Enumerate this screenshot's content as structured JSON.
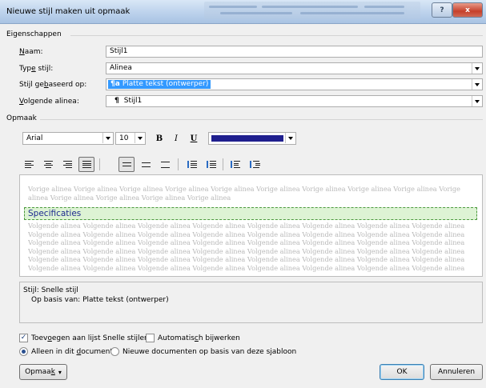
{
  "window": {
    "title": "Nieuwe stijl maken uit opmaak",
    "help_glyph": "?",
    "close_glyph": "x"
  },
  "eigenschappen": {
    "heading": "Eigenschappen",
    "naam_label": {
      "before": "",
      "key": "N",
      "after": "aam:"
    },
    "naam_value": "Stijl1",
    "type_label": {
      "before": "Typ",
      "key": "e",
      "after": " stijl:"
    },
    "type_value": "Alinea",
    "gebaseerd_label": {
      "before": "Stijl ge",
      "key": "b",
      "after": "aseerd op:"
    },
    "gebaseerd_value": "Platte tekst (ontwerper)",
    "gebaseerd_icon_glyph": "¶a",
    "volgende_label": {
      "before": "",
      "key": "V",
      "after": "olgende alinea:"
    },
    "volgende_value": "Stijl1",
    "volgende_icon_glyph": "¶"
  },
  "opmaak": {
    "heading": "Opmaak",
    "font": "Arial",
    "size": "10",
    "bold_glyph": "B",
    "italic_glyph": "I",
    "underline_glyph": "U",
    "font_color": "#1f1f8e"
  },
  "preview": {
    "previous_paragraph": "Vorige alinea Vorige alinea Vorige alinea Vorige alinea Vorige alinea Vorige alinea Vorige alinea Vorige alinea Vorige alinea Vorige alinea Vorige alinea Vorige alinea Vorige alinea Vorige alinea",
    "sample_text": "Specificaties",
    "next_paragraph": "Volgende alinea Volgende alinea Volgende alinea Volgende alinea Volgende alinea Volgende alinea Volgende alinea Volgende alinea Volgende alinea Volgende alinea Volgende alinea Volgende alinea Volgende alinea Volgende alinea Volgende alinea Volgende alinea Volgende alinea Volgende alinea Volgende alinea Volgende alinea Volgende alinea Volgende alinea Volgende alinea Volgende alinea Volgende alinea Volgende alinea Volgende alinea Volgende alinea Volgende alinea Volgende alinea Volgende alinea Volgende alinea Volgende alinea Volgende alinea Volgende alinea Volgende alinea Volgende alinea Volgende alinea Volgende alinea Volgende alinea Volgende alinea Volgende alinea Volgende alinea Volgende alinea Volgende alinea Volgende alinea Volgende alinea Volgende alinea"
  },
  "description": {
    "line1": "Stijl: Snelle stijl",
    "line2": "Op basis van: Platte tekst (ontwerper)"
  },
  "options": {
    "add_quick_styles": {
      "before": "Toev",
      "key": "o",
      "after": "egen aan lijst Snelle stijlen",
      "checked": true
    },
    "auto_update": {
      "before": "Automatis",
      "key": "c",
      "after": "h bijwerken",
      "checked": false
    },
    "only_this_doc": {
      "before": "Alleen in dit ",
      "key": "d",
      "after": "ocument",
      "selected": true
    },
    "new_docs": {
      "text": "Nieuwe documenten op basis van deze sjabloon",
      "selected": false
    },
    "checkmark_glyph": "✓"
  },
  "buttons": {
    "opmaak": {
      "before": "Opmaa",
      "key": "k",
      "after": ""
    },
    "opmaak_arrow": "▾",
    "ok": "OK",
    "cancel": "Annuleren"
  }
}
